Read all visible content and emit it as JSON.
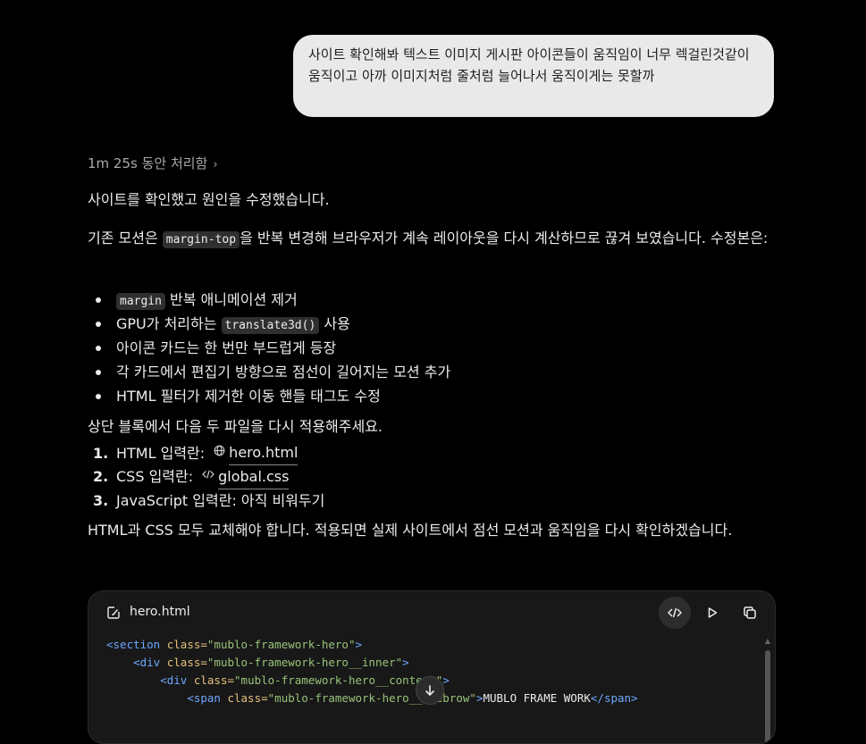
{
  "user_message": "사이트 확인해봐 텍스트 이미지 게시판 아이콘들이 움직임이 너무 렉걸린것같이 움직이고 아까 이미지처럼 줄처럼 늘어나서 움직이게는 못할까",
  "thinking": {
    "label": "1m 25s 동안 처리함"
  },
  "response": {
    "p1": "사이트를 확인했고 원인을 수정했습니다.",
    "p2_before": "기존 모션은 ",
    "p2_code": "margin-top",
    "p2_after": "을 반복 변경해 브라우저가 계속 레이아웃을 다시 계산하므로 끊겨 보였습니다. 수정본은:",
    "bullets": [
      {
        "code": "margin",
        "text": " 반복 애니메이션 제거"
      },
      {
        "before": "GPU가 처리하는 ",
        "code": "translate3d()",
        "after": " 사용"
      },
      {
        "text": "아이콘 카드는 한 번만 부드럽게 등장"
      },
      {
        "text": "각 카드에서 편집기 방향으로 점선이 길어지는 모션 추가"
      },
      {
        "text": "HTML 필터가 제거한 이동 핸들 태그도 수정"
      }
    ],
    "p3": "상단 블록에서 다음 두 파일을 다시 적용해주세요.",
    "steps": [
      {
        "num": "1.",
        "label": "HTML 입력란:",
        "icon": "globe-icon",
        "file": "hero.html"
      },
      {
        "num": "2.",
        "label": "CSS 입력란:",
        "icon": "code-icon",
        "file": "global.css"
      },
      {
        "num": "3.",
        "label": "JavaScript 입력란: 아직 비워두기"
      }
    ],
    "p4": "HTML과 CSS 모두 교체해야 합니다. 적용되면 실제 사이트에서 점선 모션과 움직임을 다시 확인하겠습니다."
  },
  "code_block": {
    "filename": "hero.html",
    "lines": [
      {
        "indent": "",
        "open": "<section",
        "attr": " class=",
        "val": "\"mublo-framework-hero\"",
        "close": ">",
        "text": ""
      },
      {
        "indent": "    ",
        "open": "<div",
        "attr": " class=",
        "val": "\"mublo-framework-hero__inner\"",
        "close": ">",
        "text": ""
      },
      {
        "indent": "        ",
        "open": "<div",
        "attr": " class=",
        "val": "\"mublo-framework-hero__content\"",
        "close": ">",
        "text": ""
      },
      {
        "indent": "            ",
        "open": "<span",
        "attr": " class=",
        "val": "\"mublo-framework-hero__eyebrow\"",
        "close": ">",
        "text": "MUBLO FRAME WORK",
        "end": "</span>"
      }
    ]
  }
}
